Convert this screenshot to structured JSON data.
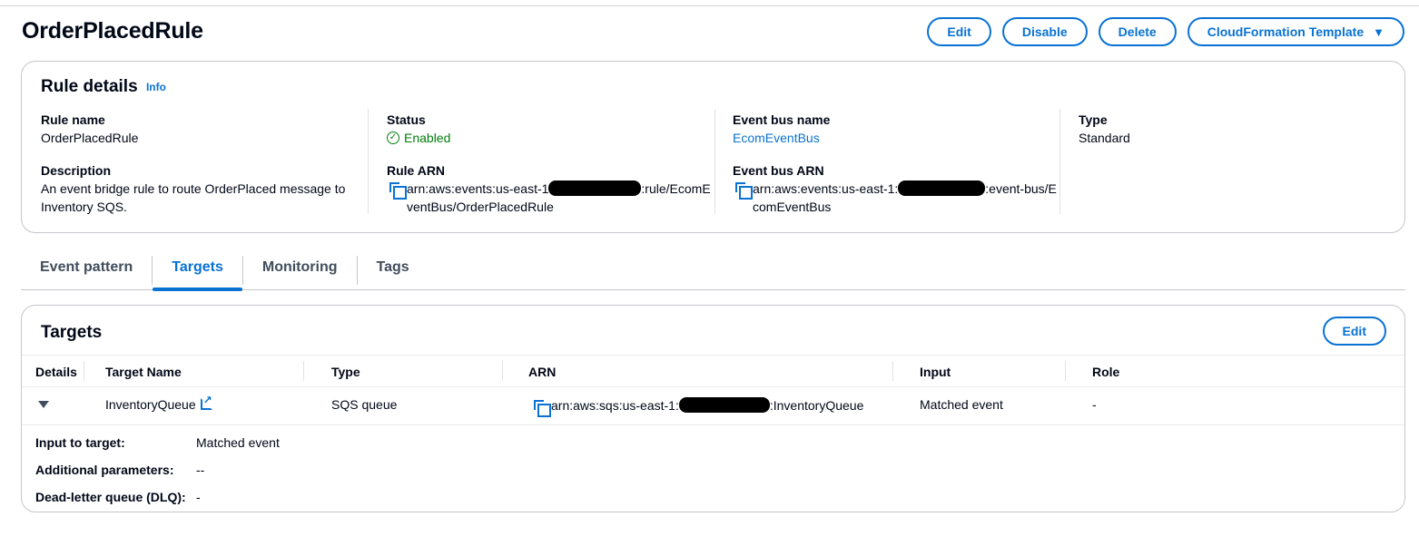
{
  "page": {
    "title": "OrderPlacedRule"
  },
  "header_actions": {
    "edit": "Edit",
    "disable": "Disable",
    "delete": "Delete",
    "cloudformation": "CloudFormation Template"
  },
  "rule_details": {
    "title": "Rule details",
    "info": "Info",
    "rule_name_label": "Rule name",
    "rule_name": "OrderPlacedRule",
    "description_label": "Description",
    "description": "An event bridge rule to route OrderPlaced message to Inventory SQS.",
    "status_label": "Status",
    "status": "Enabled",
    "rule_arn_label": "Rule ARN",
    "rule_arn_prefix": "arn:aws:events:us-east-1",
    "rule_arn_suffix": ":rule/EcomEventBus/OrderPlacedRule",
    "event_bus_name_label": "Event bus name",
    "event_bus_name": "EcomEventBus",
    "event_bus_arn_label": "Event bus ARN",
    "event_bus_arn_prefix": "arn:aws:events:us-east-1:",
    "event_bus_arn_suffix": ":event-bus/EcomEventBus",
    "type_label": "Type",
    "type": "Standard"
  },
  "tabs": [
    {
      "label": "Event pattern",
      "active": false
    },
    {
      "label": "Targets",
      "active": true
    },
    {
      "label": "Monitoring",
      "active": false
    },
    {
      "label": "Tags",
      "active": false
    }
  ],
  "targets": {
    "title": "Targets",
    "edit": "Edit",
    "columns": [
      "Details",
      "Target Name",
      "Type",
      "ARN",
      "Input",
      "Role"
    ],
    "rows": [
      {
        "target_name": "InventoryQueue",
        "type": "SQS queue",
        "arn_prefix": "arn:aws:sqs:us-east-1:",
        "arn_suffix": ":InventoryQueue",
        "input": "Matched event",
        "role": "-"
      }
    ],
    "expanded": {
      "input_label": "Input to target:",
      "input_value": "Matched event",
      "params_label": "Additional parameters:",
      "params_value": "--",
      "dlq_label": "Dead-letter queue (DLQ):",
      "dlq_value": "-"
    }
  },
  "colors": {
    "accent": "#0972d3",
    "success": "#037f0c",
    "text": "#000716"
  },
  "icons": [
    "copy-icon",
    "success-check-icon",
    "external-link-icon",
    "expand-caret-icon",
    "dropdown-caret-icon"
  ]
}
